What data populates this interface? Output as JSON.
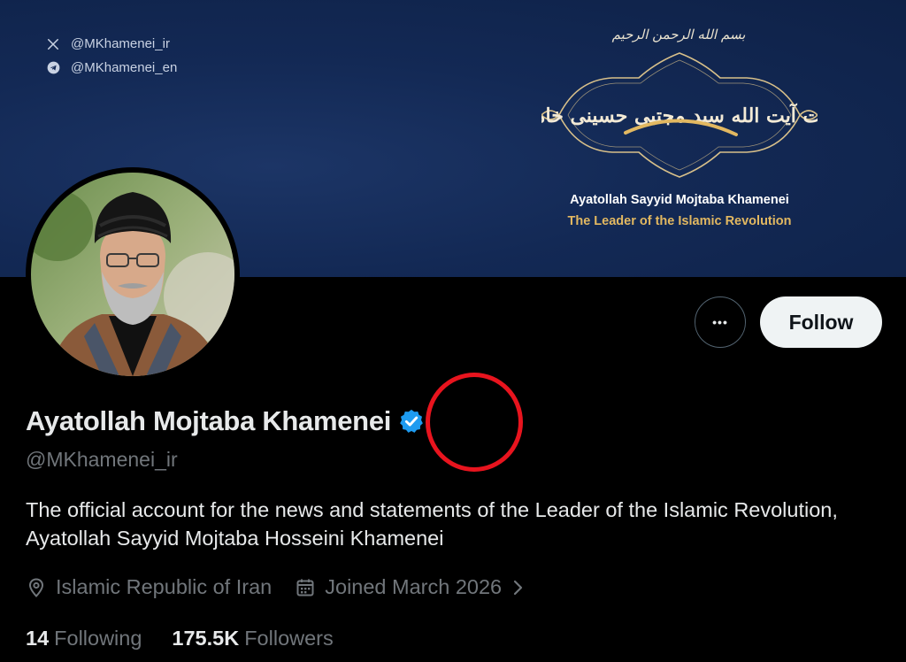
{
  "banner": {
    "social_x_handle": "@MKhamenei_ir",
    "social_telegram_handle": "@MKhamenei_en",
    "basmala": "بسم الله الرحمن الرحیم",
    "calligraphy_text": "حضرت آیت الله سید مجتبی حسینی خامنه‌ای",
    "title": "Ayatollah Sayyid Mojtaba Khamenei",
    "subtitle": "The Leader of the Islamic Revolution",
    "colors": {
      "background": "#132955",
      "gold": "#e2b861"
    }
  },
  "actions": {
    "more_label": "•••",
    "follow_label": "Follow"
  },
  "profile": {
    "display_name": "Ayatollah Mojtaba Khamenei",
    "verified": true,
    "handle": "@MKhamenei_ir",
    "bio": "The official account for the news and statements of the Leader of the Islamic Revolution, Ayatollah Sayyid Mojtaba Hosseini Khamenei",
    "location": "Islamic Republic of Iran",
    "joined": "Joined March 2026",
    "following_count": "14",
    "following_label": "Following",
    "followers_count": "175.5K",
    "followers_label": "Followers"
  },
  "icons": {
    "x": "x-logo-icon",
    "telegram": "telegram-icon",
    "location": "location-pin-icon",
    "calendar": "calendar-icon",
    "chevron": "chevron-right-icon",
    "verified": "verified-badge-icon"
  },
  "colors": {
    "verified_blue": "#1d9bf0",
    "annotation_red": "#e8141e",
    "secondary_text": "#71767b"
  }
}
